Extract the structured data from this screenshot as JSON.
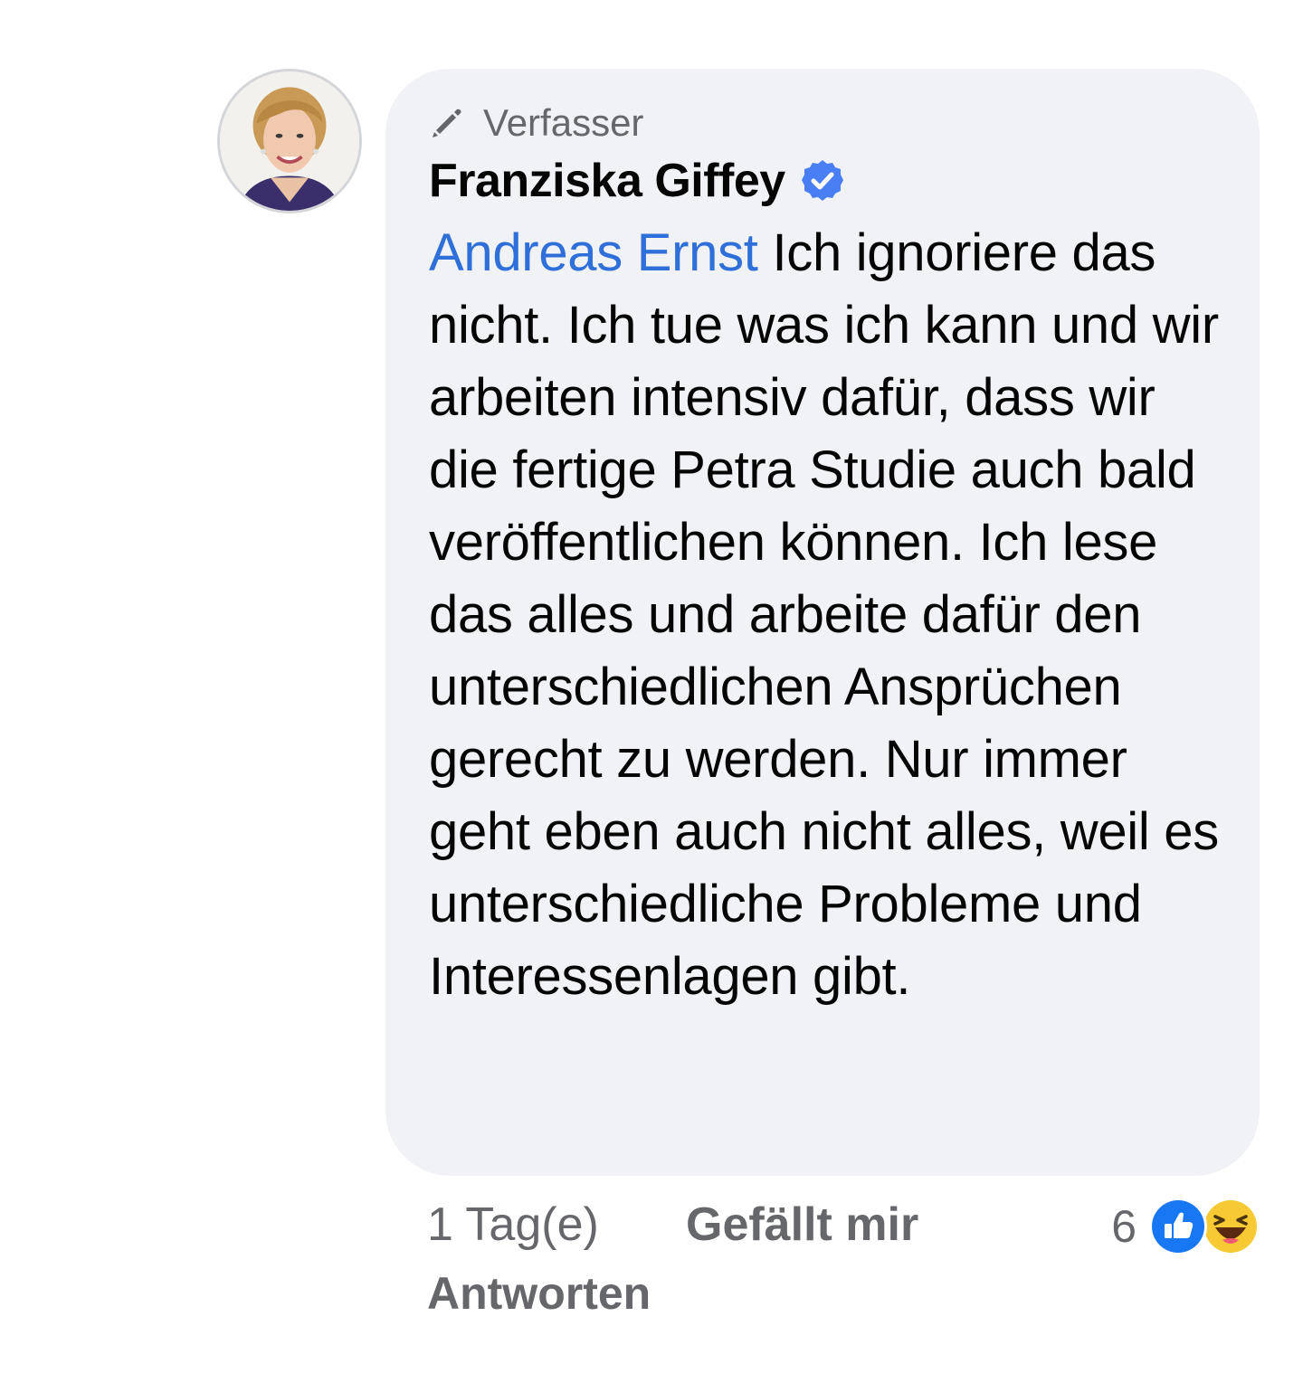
{
  "comment": {
    "author_badge": "Verfasser",
    "author_badge_icon": "pencil-icon",
    "author_name": "Franziska Giffey",
    "verified_icon": "verified-badge-icon",
    "mention": "Andreas Ernst",
    "text": " Ich ignoriere das nicht. Ich tue was ich kann und wir arbeiten intensiv dafür, dass wir die fertige Petra Studie auch bald veröffentlichen können. Ich lese das alles und arbeite dafür den unterschiedlichen Ansprüchen gerecht zu werden. Nur immer geht eben auch nicht alles, weil es unterschiedliche Probleme und Interessenlagen gibt."
  },
  "footer": {
    "timestamp": "1 Tag(e)",
    "like_label": "Gefällt mir",
    "reply_label": "Antworten",
    "reaction_count": "6",
    "reactions": [
      "like-reaction-icon",
      "haha-reaction-icon"
    ]
  },
  "colors": {
    "bubble_bg": "#f0f2f5",
    "mention": "#2e6fd9",
    "verified": "#4a7ef5",
    "secondary_text": "#65676b",
    "like_blue": "#1877f2",
    "haha_yellow": "#f7c932"
  }
}
